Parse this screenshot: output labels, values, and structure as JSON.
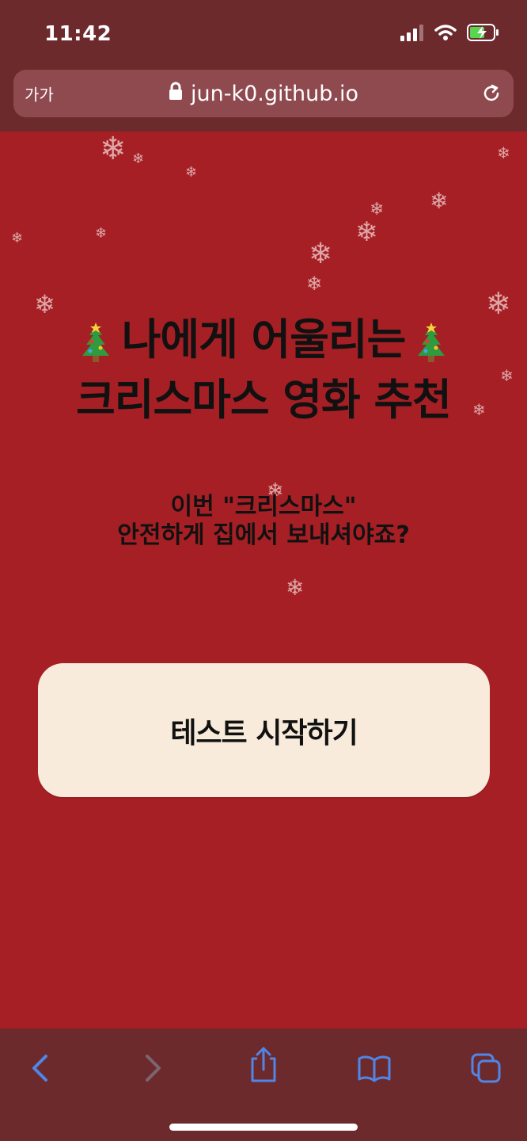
{
  "status_bar": {
    "time": "11:42",
    "icons": [
      "signal-icon",
      "wifi-icon",
      "battery-charging-icon"
    ]
  },
  "browser": {
    "reader_label": "가가",
    "url": "jun-k0.github.io",
    "reload_icon": "reload-icon",
    "lock_icon": "lock-icon"
  },
  "page": {
    "title_line1": "나에게 어울리는",
    "title_line2": "크리스마스 영화 추천",
    "subtitle_line1": "이번 \"크리스마스\"",
    "subtitle_line2": "안전하게 집에서 보내셔야죠?",
    "start_button": "테스트 시작하기",
    "decor_icon": "christmas-tree-icon",
    "snow_icon": "snowflake-icon"
  },
  "toolbar": {
    "icons": [
      "back-icon",
      "forward-icon",
      "share-icon",
      "bookmarks-icon",
      "tabs-icon"
    ]
  },
  "colors": {
    "page_background": "#a51f24",
    "chrome_background": "#6d2a2d",
    "address_bar": "#8f4a50",
    "button_background": "#f9ebdb",
    "toolbar_icons_active": "#4f86e7",
    "toolbar_icons_disabled": "#7b6670"
  }
}
